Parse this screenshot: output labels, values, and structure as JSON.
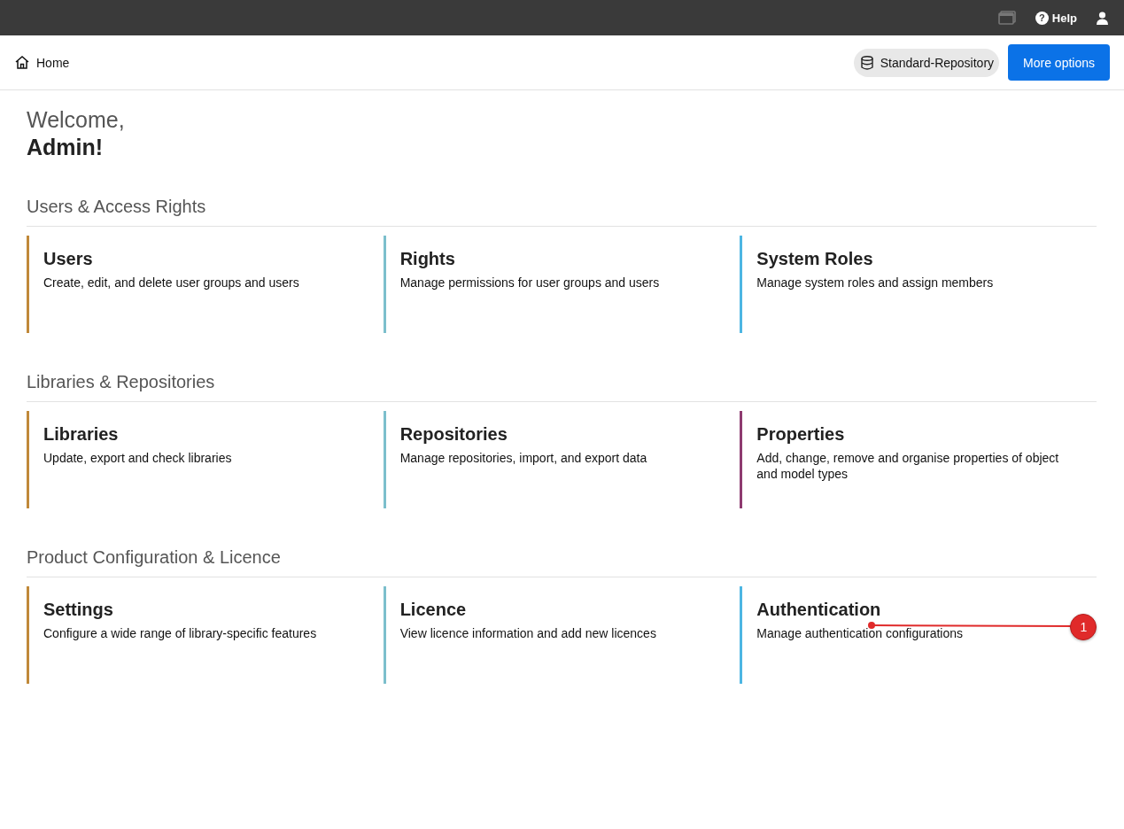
{
  "top_bar": {
    "help_icon": "?",
    "help_label": "Help"
  },
  "header": {
    "breadcrumb": "Home",
    "repository": "Standard-Repository",
    "more_button": "More options"
  },
  "welcome": {
    "greeting": "Welcome,",
    "name": "Admin!"
  },
  "sections": [
    {
      "title": "Users & Access Rights",
      "cards": [
        {
          "title": "Users",
          "description": "Create, edit, and delete user groups and users",
          "color": "#c0893a"
        },
        {
          "title": "Rights",
          "description": "Manage permissions for user groups and users",
          "color": "#7cbfcc"
        },
        {
          "title": "System Roles",
          "description": "Manage system roles and assign members",
          "color": "#4db6e3"
        }
      ]
    },
    {
      "title": "Libraries & Repositories",
      "cards": [
        {
          "title": "Libraries",
          "description": "Update, export and check libraries",
          "color": "#c0893a"
        },
        {
          "title": "Repositories",
          "description": "Manage repositories, import, and export data",
          "color": "#7cbfcc"
        },
        {
          "title": "Properties",
          "description": "Add, change, remove and organise properties of object and model types",
          "color": "#8e3b70"
        }
      ]
    },
    {
      "title": "Product Configuration & Licence",
      "cards": [
        {
          "title": "Settings",
          "description": "Configure a wide range of library-specific features",
          "color": "#c0893a"
        },
        {
          "title": "Licence",
          "description": "View licence information and add new licences",
          "color": "#7cbfcc"
        },
        {
          "title": "Authentication",
          "description": "Manage authentication configurations",
          "color": "#4db6e3",
          "callout": "1"
        }
      ]
    }
  ]
}
